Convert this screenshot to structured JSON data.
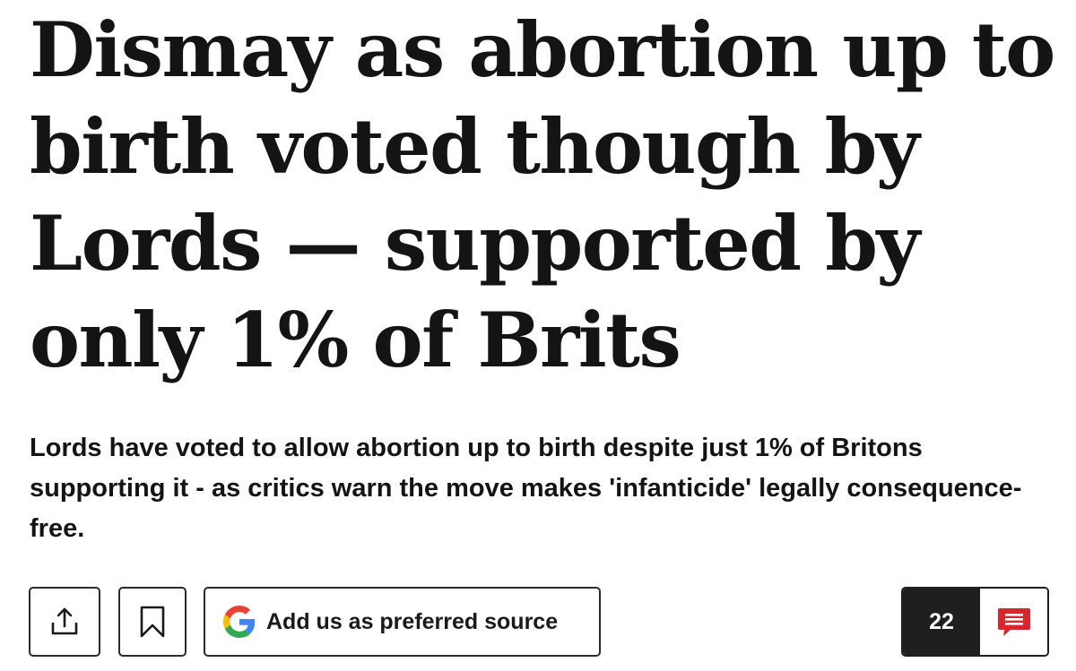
{
  "article": {
    "headline": "Dismay as abortion up to birth voted though by Lords — supported by only 1% of Brits",
    "standfirst": "Lords have voted to allow abortion up to birth despite just 1% of Britons supporting it - as critics warn the move makes 'infanticide' legally consequence-free."
  },
  "actions": {
    "share_icon": "share-icon",
    "bookmark_icon": "bookmark-icon",
    "preferred_source_icon": "google-g-icon",
    "preferred_source_label": "Add us as preferred source",
    "comment_count": "22",
    "comment_icon": "comment-icon"
  },
  "colors": {
    "text": "#141414",
    "border": "#2b2b2b",
    "comment_count_bg": "#1f1f1f",
    "comment_icon": "#d8262d",
    "google_blue": "#4285F4",
    "google_red": "#EA4335",
    "google_yellow": "#FBBC05",
    "google_green": "#34A853"
  }
}
